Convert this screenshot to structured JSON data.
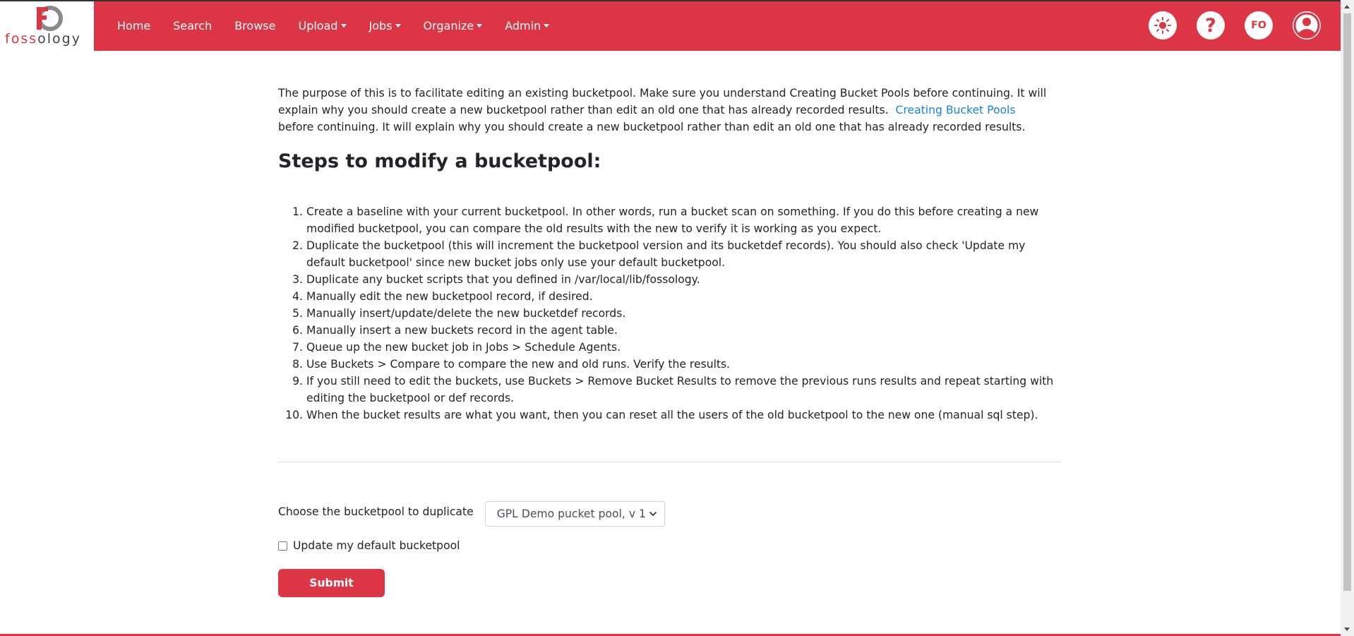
{
  "navbar": {
    "logo_prefix": "foss",
    "logo_suffix": "ology",
    "links": {
      "home": "Home",
      "search": "Search",
      "browse": "Browse",
      "upload": "Upload",
      "jobs": "Jobs",
      "organize": "Organize",
      "admin": "Admin"
    },
    "user_initials": "FO",
    "help_glyph": "?",
    "icons": [
      "sun-icon",
      "help-icon",
      "user-initials-badge",
      "user-avatar-icon"
    ],
    "colors": {
      "brand": "#dc3545"
    }
  },
  "intro": {
    "text1": "The purpose of this is to facilitate editing an existing bucketpool. Make sure you understand Creating Bucket Pools before continuing. It will explain why you should create a new bucketpool rather than edit an old one that has already recorded results.",
    "link": "Creating Bucket Pools",
    "text2": "before continuing. It will explain why you should create a new bucketpool rather than edit an old one that has already recorded results."
  },
  "heading": "Steps to modify a bucketpool:",
  "steps": [
    "Create a baseline with your current bucketpool. In other words, run a bucket scan on something. If you do this before creating a new modified bucketpool, you can compare the old results with the new to verify it is working as you expect.",
    "Duplicate the bucketpool (this will increment the bucketpool version and its bucketdef records). You should also check 'Update my default bucketpool' since new bucket jobs only use your default bucketpool.",
    "Duplicate any bucket scripts that you defined in /var/local/lib/fossology.",
    "Manually edit the new bucketpool record, if desired.",
    "Manually insert/update/delete the new bucketdef records.",
    "Manually insert a new buckets record in the agent table.",
    "Queue up the new bucket job in Jobs > Schedule Agents.",
    "Use Buckets > Compare to compare the new and old runs. Verify the results.",
    "If you still need to edit the buckets, use Buckets > Remove Bucket Results to remove the previous runs results and repeat starting with editing the bucketpool or def records.",
    "When the bucket results are what you want, then you can reset all the users of the old bucketpool to the new one (manual sql step)."
  ],
  "form": {
    "choose_label": "Choose the bucketpool to duplicate",
    "selected_pool": "GPL Demo pucket pool, v 1",
    "checkbox_label": "Update my default bucketpool",
    "checkbox_checked": false,
    "submit_label": "Submit"
  }
}
